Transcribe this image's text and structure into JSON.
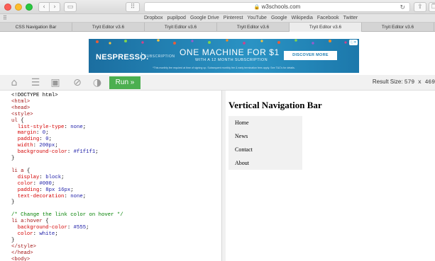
{
  "browser": {
    "address": "w3schools.com",
    "bookmarks": [
      "Dropbox",
      "pupilpod",
      "Google Drive",
      "Pinterest",
      "YouTube",
      "Google",
      "Wikipedia",
      "Facebook",
      "Twitter"
    ],
    "tabs": [
      {
        "label": "CSS Navigation Bar",
        "active": false
      },
      {
        "label": "Tryit Editor v3.6",
        "active": false
      },
      {
        "label": "Tryit Editor v3.6",
        "active": false
      },
      {
        "label": "Tryit Editor v3.6",
        "active": false
      },
      {
        "label": "Tryit Editor v3.6",
        "active": true
      },
      {
        "label": "Tryit Editor v3.6",
        "active": false
      }
    ]
  },
  "ad": {
    "logo": "NESPRESSO.",
    "sub": "SUBSCRIPTION",
    "headline": "ONE MACHINE FOR $1",
    "subline": "WITH A 12 MONTH SUBSCRIPTION",
    "cta": "DISCOVER MORE",
    "fine_print": "*This monthly fee required at time of signing up. Subsequent monthly fee & early termination fees apply. See T&C's for details.",
    "accent_color": "#2a93c4"
  },
  "toolbar": {
    "run_label": "Run »",
    "result_size_label": "Result Size:",
    "result_size_value": "579 x 469",
    "icons": [
      "home-icon",
      "menu-icon",
      "save-icon",
      "no-direction-icon",
      "theme-icon"
    ],
    "run_color": "#4caf50"
  },
  "editor": {
    "lines": [
      [
        {
          "t": "<!DOCTYPE html>",
          "c": ""
        }
      ],
      [
        {
          "t": "<html>",
          "c": "tag"
        }
      ],
      [
        {
          "t": "<head>",
          "c": "tag"
        }
      ],
      [
        {
          "t": "<style>",
          "c": "tag"
        }
      ],
      [
        {
          "t": "ul",
          "c": "sel"
        },
        {
          "t": " {",
          "c": ""
        }
      ],
      [
        {
          "t": "  list-style-type",
          "c": "prop"
        },
        {
          "t": ": ",
          "c": ""
        },
        {
          "t": "none",
          "c": "val"
        },
        {
          "t": ";",
          "c": ""
        }
      ],
      [
        {
          "t": "  margin",
          "c": "prop"
        },
        {
          "t": ": ",
          "c": ""
        },
        {
          "t": "0",
          "c": "val"
        },
        {
          "t": ";",
          "c": ""
        }
      ],
      [
        {
          "t": "  padding",
          "c": "prop"
        },
        {
          "t": ": ",
          "c": ""
        },
        {
          "t": "0",
          "c": "val"
        },
        {
          "t": ";",
          "c": ""
        }
      ],
      [
        {
          "t": "  width",
          "c": "prop"
        },
        {
          "t": ": ",
          "c": ""
        },
        {
          "t": "200px",
          "c": "val"
        },
        {
          "t": ";",
          "c": ""
        }
      ],
      [
        {
          "t": "  background-color",
          "c": "prop"
        },
        {
          "t": ": ",
          "c": ""
        },
        {
          "t": "#f1f1f1",
          "c": "val"
        },
        {
          "t": ";",
          "c": ""
        }
      ],
      [
        {
          "t": "}",
          "c": ""
        }
      ],
      [
        {
          "t": "",
          "c": ""
        }
      ],
      [
        {
          "t": "li a",
          "c": "sel"
        },
        {
          "t": " {",
          "c": ""
        }
      ],
      [
        {
          "t": "  display",
          "c": "prop"
        },
        {
          "t": ": ",
          "c": ""
        },
        {
          "t": "block",
          "c": "val"
        },
        {
          "t": ";",
          "c": ""
        }
      ],
      [
        {
          "t": "  color",
          "c": "prop"
        },
        {
          "t": ": ",
          "c": ""
        },
        {
          "t": "#000",
          "c": "val"
        },
        {
          "t": ";",
          "c": ""
        }
      ],
      [
        {
          "t": "  padding",
          "c": "prop"
        },
        {
          "t": ": ",
          "c": ""
        },
        {
          "t": "8px 16px",
          "c": "val"
        },
        {
          "t": ";",
          "c": ""
        }
      ],
      [
        {
          "t": "  text-decoration",
          "c": "prop"
        },
        {
          "t": ": ",
          "c": ""
        },
        {
          "t": "none",
          "c": "val"
        },
        {
          "t": ";",
          "c": ""
        }
      ],
      [
        {
          "t": "}",
          "c": ""
        }
      ],
      [
        {
          "t": "",
          "c": ""
        }
      ],
      [
        {
          "t": "/* Change the link color on hover */",
          "c": "com"
        }
      ],
      [
        {
          "t": "li a:hover",
          "c": "sel"
        },
        {
          "t": " {",
          "c": ""
        }
      ],
      [
        {
          "t": "  background-color",
          "c": "prop"
        },
        {
          "t": ": ",
          "c": ""
        },
        {
          "t": "#555",
          "c": "val"
        },
        {
          "t": ";",
          "c": ""
        }
      ],
      [
        {
          "t": "  color",
          "c": "prop"
        },
        {
          "t": ": ",
          "c": ""
        },
        {
          "t": "white",
          "c": "val"
        },
        {
          "t": ";",
          "c": ""
        }
      ],
      [
        {
          "t": "}",
          "c": ""
        }
      ],
      [
        {
          "t": "</style>",
          "c": "tag"
        }
      ],
      [
        {
          "t": "</head>",
          "c": "tag"
        }
      ],
      [
        {
          "t": "<body>",
          "c": "tag"
        }
      ]
    ]
  },
  "result": {
    "heading": "Vertical Navigation Bar",
    "nav_items": [
      "Home",
      "News",
      "Contact",
      "About"
    ],
    "nav_bg": "#f1f1f1"
  }
}
